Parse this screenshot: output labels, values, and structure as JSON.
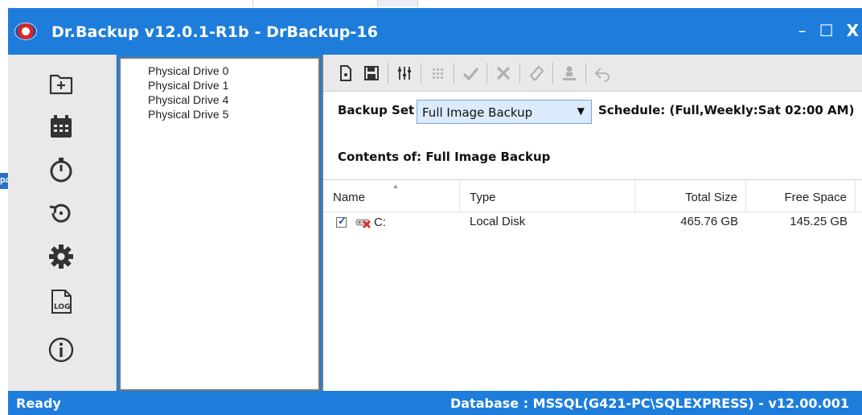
{
  "window": {
    "title": "Dr.Backup v12.0.1-R1b  - DrBackup-16",
    "controls": {
      "minimize": "–",
      "maximize": "☐",
      "close": "X"
    }
  },
  "rail": {
    "icons": [
      "new-folder-icon",
      "calendar-icon",
      "stopwatch-icon",
      "restore-icon",
      "settings-gear-icon",
      "log-file-icon",
      "info-icon"
    ]
  },
  "drives": {
    "items": [
      "Physical Drive 0",
      "Physical Drive 1",
      "Physical Drive 4",
      "Physical Drive 5"
    ]
  },
  "toolbar": {
    "icons": [
      "new-document-icon",
      "save-icon",
      "filter-settings-icon",
      "grid-icon",
      "checkmark-icon",
      "cross-icon",
      "eraser-icon",
      "user-upload-icon",
      "undo-icon"
    ]
  },
  "backup": {
    "label": "Backup Set",
    "selected": "Full Image Backup",
    "schedule": "Schedule: (Full,Weekly:Sat 02:00 AM)"
  },
  "contents": {
    "label": "Contents of: Full Image Backup"
  },
  "table": {
    "headers": {
      "name": "Name",
      "type": "Type",
      "total": "Total Size",
      "free": "Free Space"
    },
    "rows": [
      {
        "name": "C:",
        "type": "Local Disk",
        "total": "465.76 GB",
        "free": "145.25 GB",
        "checked": true
      }
    ]
  },
  "status": {
    "left": "Ready",
    "right": "Database : MSSQL(G421-PC\\SQLEXPRESS) - v12.00.001"
  },
  "background": {
    "edge_fragment": "pa"
  },
  "colors": {
    "accent": "#1e7ddb",
    "panel": "#e9e9e9",
    "select_bg": "#dcebfb"
  }
}
